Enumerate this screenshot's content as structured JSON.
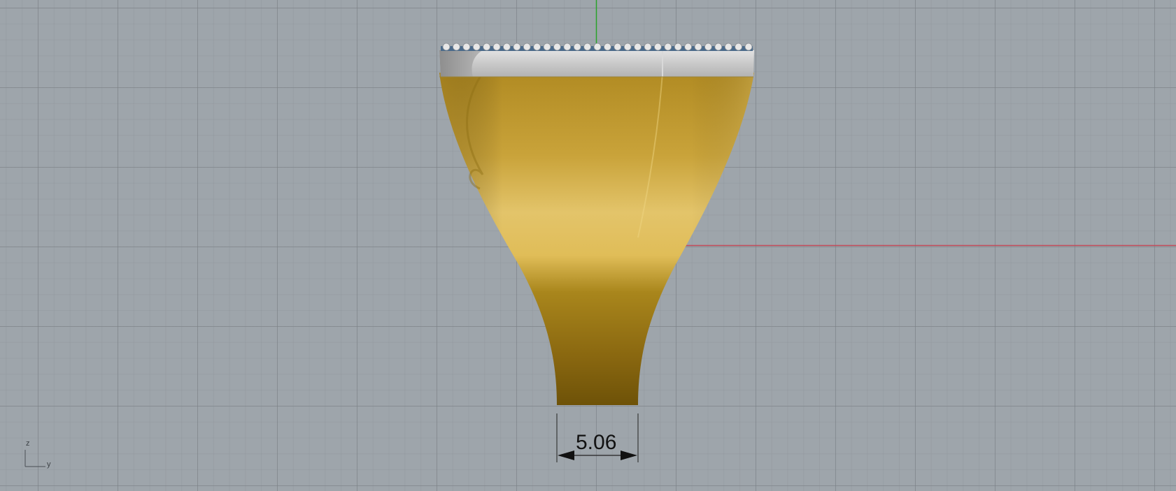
{
  "viewport": {
    "background_color": "#9ea5ab",
    "x_axis_color": "#c24a5a",
    "y_axis_color": "#2aa32a",
    "ring_shank_color": "#c8a030",
    "top_band_color": "#c4c4c4",
    "gem_setting_color": "#4a6a8a"
  },
  "dimension": {
    "value": "5.06"
  },
  "axis_widget": {
    "z_label": "z",
    "y_label": "y"
  }
}
